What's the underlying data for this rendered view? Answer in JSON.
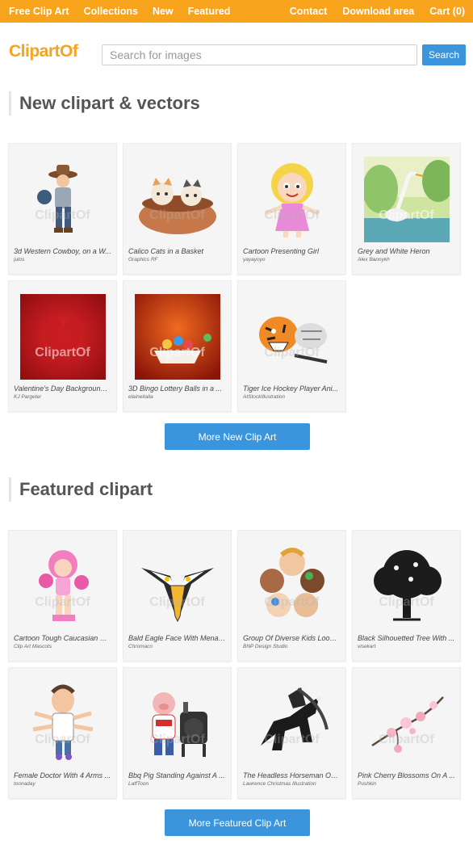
{
  "topnav": {
    "left": [
      "Free Clip Art",
      "Collections",
      "New",
      "Featured"
    ],
    "right": [
      "Contact",
      "Download area",
      "Cart (0)"
    ]
  },
  "brand": {
    "logo": "ClipartOf",
    "accent": "#f7a31c",
    "button_blue": "#3b95dc"
  },
  "search": {
    "placeholder": "Search for images",
    "button": "Search"
  },
  "watermark": "ClipartOf",
  "new_section": {
    "title": "New clipart & vectors",
    "more_button": "More New Clip Art",
    "items": [
      {
        "title": "3d Western Cowboy, on a W...",
        "author": "julos",
        "thumb": "cowboy"
      },
      {
        "title": "Calico Cats in a Basket",
        "author": "Graphics RF",
        "thumb": "cats"
      },
      {
        "title": "Cartoon Presenting Girl",
        "author": "yayayoyo",
        "thumb": "girl"
      },
      {
        "title": "Grey and White Heron",
        "author": "Alex Bannykh",
        "thumb": "heron"
      },
      {
        "title": "Valentine's Day Background ...",
        "author": "KJ Pargeter",
        "thumb": "valentine"
      },
      {
        "title": "3D Bingo Lottery Balls in a ...",
        "author": "elaineitalia",
        "thumb": "bingo"
      },
      {
        "title": "Tiger Ice Hockey Player Ani...",
        "author": "AtStockIllustration",
        "thumb": "tiger"
      }
    ]
  },
  "featured_section": {
    "title": "Featured clipart",
    "more_button": "More Featured Clip Art",
    "items": [
      {
        "title": "Cartoon Tough Caucasian W...",
        "author": "Clip Art Mascots",
        "thumb": "boxer"
      },
      {
        "title": "Bald Eagle Face With Menac...",
        "author": "Chromaco",
        "thumb": "eagle"
      },
      {
        "title": "Group Of Diverse Kids Looki...",
        "author": "BNP Design Studio",
        "thumb": "kids"
      },
      {
        "title": "Black Silhouetted Tree With ...",
        "author": "visekart",
        "thumb": "tree"
      },
      {
        "title": "Female Doctor With 4 Arms ...",
        "author": "toonaday",
        "thumb": "doctor"
      },
      {
        "title": "Bbq Pig Standing Against A ...",
        "author": "LaffToon",
        "thumb": "pig"
      },
      {
        "title": "The Headless Horseman On...",
        "author": "Lawrence Christmas Illustration",
        "thumb": "horseman"
      },
      {
        "title": "Pink Cherry Blossoms On A ...",
        "author": "Pushkin",
        "thumb": "blossoms"
      }
    ]
  }
}
